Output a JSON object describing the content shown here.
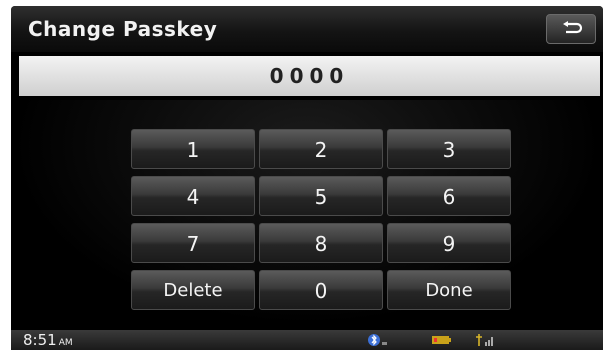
{
  "header": {
    "title": "Change Passkey"
  },
  "passkey": {
    "value": "0000"
  },
  "keypad": {
    "keys": [
      "1",
      "2",
      "3",
      "4",
      "5",
      "6",
      "7",
      "8",
      "9",
      "Delete",
      "0",
      "Done"
    ]
  },
  "status": {
    "time": "8:51",
    "ampm": "AM"
  },
  "icons": {
    "back": "back-arrow-icon",
    "bluetooth": "bluetooth-icon",
    "battery": "battery-icon",
    "signal": "signal-icon"
  },
  "colors": {
    "background": "#000000",
    "field": "#e6e6e6",
    "text": "#f4f4f4"
  }
}
